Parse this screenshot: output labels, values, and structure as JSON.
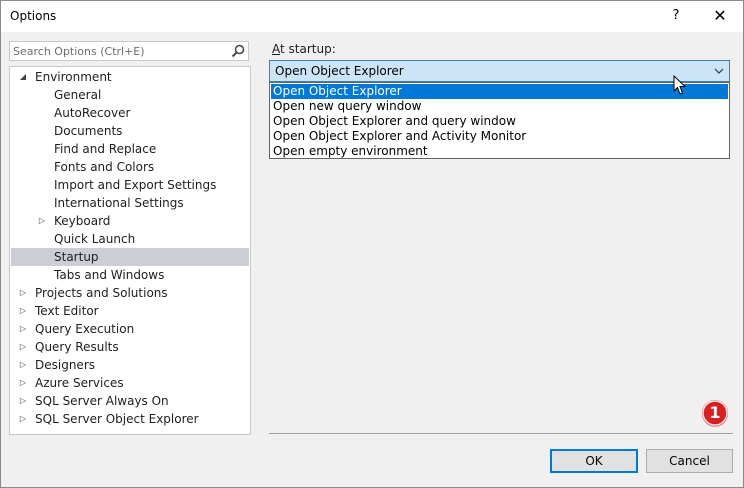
{
  "window": {
    "title": "Options",
    "help_label": "?",
    "close_label": "✕"
  },
  "search": {
    "placeholder": "Search Options (Ctrl+E)",
    "icon": "search-icon"
  },
  "tree": [
    {
      "label": "Environment",
      "expander": "◢"
    },
    {
      "label": "General",
      "expander": ""
    },
    {
      "label": "AutoRecover",
      "expander": ""
    },
    {
      "label": "Documents",
      "expander": ""
    },
    {
      "label": "Find and Replace",
      "expander": ""
    },
    {
      "label": "Fonts and Colors",
      "expander": ""
    },
    {
      "label": "Import and Export Settings",
      "expander": ""
    },
    {
      "label": "International Settings",
      "expander": ""
    },
    {
      "label": "Keyboard",
      "expander": "▷"
    },
    {
      "label": "Quick Launch",
      "expander": ""
    },
    {
      "label": "Startup",
      "expander": ""
    },
    {
      "label": "Tabs and Windows",
      "expander": ""
    },
    {
      "label": "Projects and Solutions",
      "expander": "▷"
    },
    {
      "label": "Text Editor",
      "expander": "▷"
    },
    {
      "label": "Query Execution",
      "expander": "▷"
    },
    {
      "label": "Query Results",
      "expander": "▷"
    },
    {
      "label": "Designers",
      "expander": "▷"
    },
    {
      "label": "Azure Services",
      "expander": "▷"
    },
    {
      "label": "SQL Server Always On",
      "expander": "▷"
    },
    {
      "label": "SQL Server Object Explorer",
      "expander": "▷"
    }
  ],
  "startup": {
    "label_accel": "A",
    "label_rest": "t startup:",
    "selected": "Open Object Explorer",
    "options": [
      "Open Object Explorer",
      "Open new query window",
      "Open Object Explorer and query window",
      "Open Object Explorer and Activity Monitor",
      "Open empty environment"
    ]
  },
  "badge": {
    "text": "1",
    "color": "#d91f1f"
  },
  "buttons": {
    "ok": "OK",
    "cancel": "Cancel"
  },
  "colors": {
    "selection": "#0078d7",
    "tree_selected": "#ccced6",
    "combo_bg": "#cce4f7"
  }
}
